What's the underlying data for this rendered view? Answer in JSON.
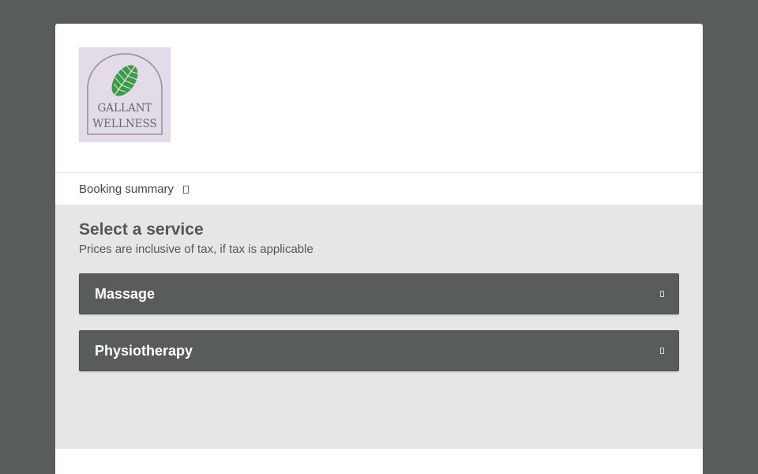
{
  "header": {
    "logo_text_line1": "GALLANT",
    "logo_text_line2": "WELLNESS"
  },
  "summary": {
    "label": "Booking summary"
  },
  "main": {
    "title": "Select a service",
    "subtitle": "Prices are inclusive of tax, if tax is applicable",
    "services": [
      {
        "label": "Massage"
      },
      {
        "label": "Physiotherapy"
      }
    ]
  },
  "colors": {
    "page_background": "#585d59",
    "service_background": "#585d59",
    "main_background": "#e6e6e6",
    "logo_background": "#e4dbe8"
  }
}
